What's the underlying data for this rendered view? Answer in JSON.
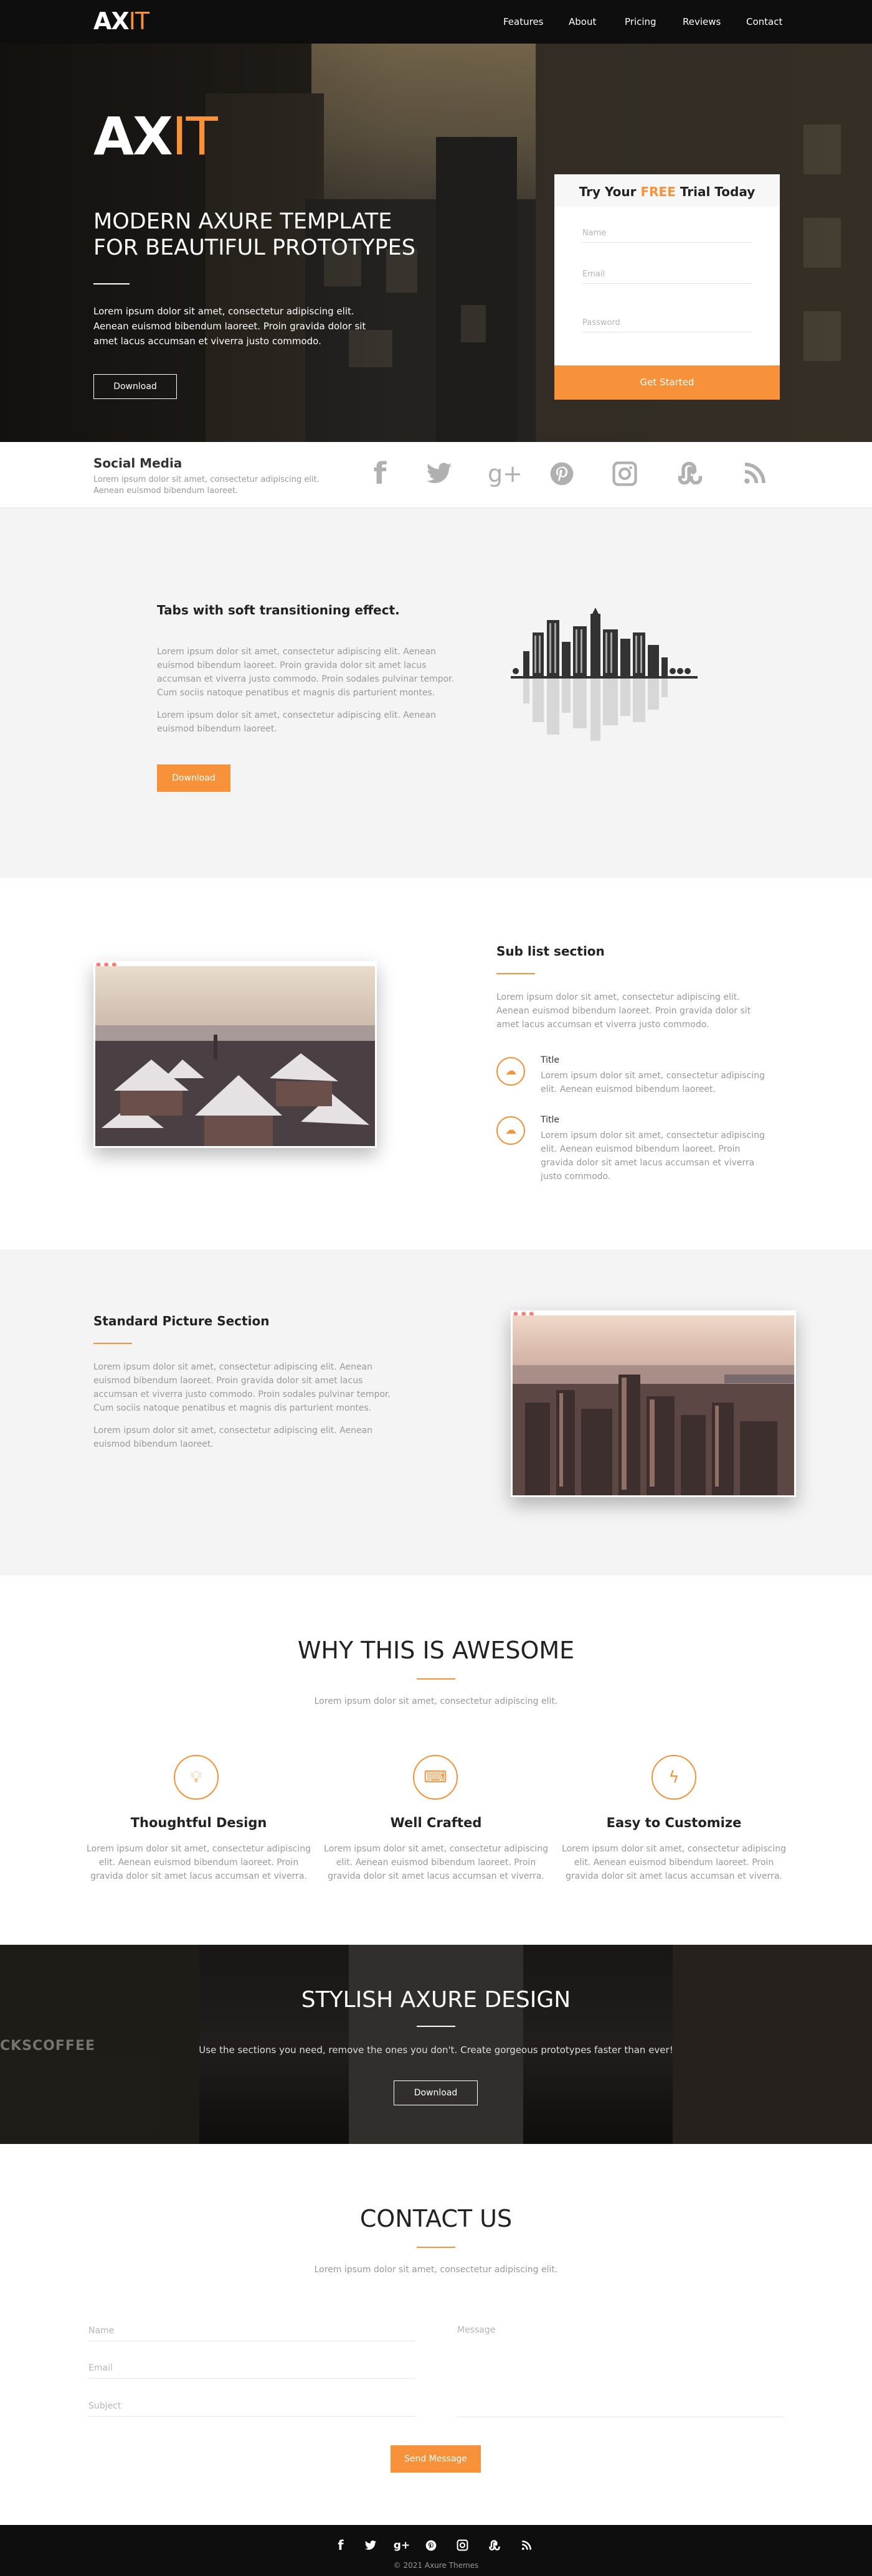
{
  "nav": {
    "logo_a": "AX",
    "logo_b": "IT",
    "links": [
      "Features",
      "About",
      "Pricing",
      "Reviews",
      "Contact"
    ]
  },
  "hero": {
    "logo_a": "AX",
    "logo_b": "IT",
    "title_line1": "MODERN AXURE TEMPLATE",
    "title_line2": "FOR BEAUTIFUL PROTOTYPES",
    "text": "Lorem ipsum dolor sit amet, consectetur adipiscing elit. Aenean euismod bibendum laoreet. Proin gravida dolor sit amet lacus accumsan et viverra justo commodo.",
    "button": "Download"
  },
  "trial_form": {
    "title_a": "Try Your",
    "title_free": "FREE",
    "title_b": "Trial Today",
    "name_placeholder": "Name",
    "email_placeholder": "Email",
    "password_placeholder": "Password",
    "submit": "Get Started"
  },
  "social": {
    "title": "Social Media",
    "text": "Lorem ipsum dolor sit amet, consectetur adipiscing elit. Aenean euismod bibendum laoreet.",
    "icons": [
      "facebook-icon",
      "twitter-icon",
      "google-plus-icon",
      "pinterest-icon",
      "instagram-icon",
      "stumbleupon-icon",
      "rss-icon"
    ]
  },
  "tabs_section": {
    "title": "Tabs with soft transitioning effect.",
    "para1": "Lorem ipsum dolor sit amet, consectetur adipiscing elit. Aenean euismod bibendum laoreet. Proin gravida dolor sit amet lacus accumsan et viverra justo commodo. Proin sodales pulvinar tempor. Cum sociis natoque penatibus et magnis dis parturient montes.",
    "para2": "Lorem ipsum dolor sit amet, consectetur adipiscing elit. Aenean euismod bibendum laoreet.",
    "button": "Download"
  },
  "sublist_section": {
    "title": "Sub list section",
    "text": "Lorem ipsum dolor sit amet, consectetur adipiscing elit. Aenean euismod bibendum laoreet. Proin gravida dolor sit amet lacus accumsan et viverra justo commodo.",
    "items": [
      {
        "title": "Title",
        "text": "Lorem ipsum dolor sit amet, consectetur adipiscing elit. Aenean euismod bibendum laoreet."
      },
      {
        "title": "Title",
        "text": "Lorem ipsum dolor sit amet, consectetur adipiscing elit. Aenean euismod bibendum laoreet. Proin gravida dolor sit amet lacus accumsan et viverra justo commodo."
      }
    ]
  },
  "standard_section": {
    "title": "Standard Picture Section",
    "para1": "Lorem ipsum dolor sit amet, consectetur adipiscing elit. Aenean euismod bibendum laoreet. Proin gravida dolor sit amet lacus accumsan et viverra justo commodo. Proin sodales pulvinar tempor. Cum sociis natoque penatibus et magnis dis parturient montes.",
    "para2": "Lorem ipsum dolor sit amet, consectetur adipiscing elit. Aenean euismod bibendum laoreet."
  },
  "why_section": {
    "title": "WHY THIS IS AWESOME",
    "subtitle": "Lorem ipsum dolor sit amet, consectetur adipiscing elit.",
    "features": [
      {
        "icon": "lightbulb-icon",
        "title": "Thoughtful Design",
        "text": "Lorem ipsum dolor sit amet, consectetur adipiscing elit. Aenean euismod bibendum laoreet. Proin gravida dolor sit amet lacus accumsan et viverra."
      },
      {
        "icon": "keyboard-icon",
        "title": "Well Crafted",
        "text": "Lorem ipsum dolor sit amet, consectetur adipiscing elit. Aenean euismod bibendum laoreet. Proin gravida dolor sit amet lacus accumsan et viverra."
      },
      {
        "icon": "lightning-icon",
        "title": "Easy to Customize",
        "text": "Lorem ipsum dolor sit amet, consectetur adipiscing elit. Aenean euismod bibendum laoreet. Proin gravida dolor sit amet lacus accumsan et viverra."
      }
    ]
  },
  "stylish_section": {
    "title": "STYLISH AXURE DESIGN",
    "text": "Use the sections you need, remove the ones you don't.  Create gorgeous prototypes faster than ever!",
    "button": "Download",
    "shop_sign": "CKSCOFFEE"
  },
  "contact": {
    "title": "CONTACT US",
    "subtitle": "Lorem ipsum dolor sit amet, consectetur adipiscing elit.",
    "name_placeholder": "Name",
    "email_placeholder": "Email",
    "subject_placeholder": "Subject",
    "message_placeholder": "Message",
    "submit": "Send Message"
  },
  "footer": {
    "icons": [
      "facebook-icon",
      "twitter-icon",
      "google-plus-icon",
      "pinterest-icon",
      "instagram-icon",
      "stumbleupon-icon",
      "rss-icon"
    ],
    "copyright": "© 2021 Axure Themes"
  },
  "colors": {
    "accent": "#f7923a",
    "dark": "#0e0e0e",
    "light_bg": "#f4f4f4"
  }
}
